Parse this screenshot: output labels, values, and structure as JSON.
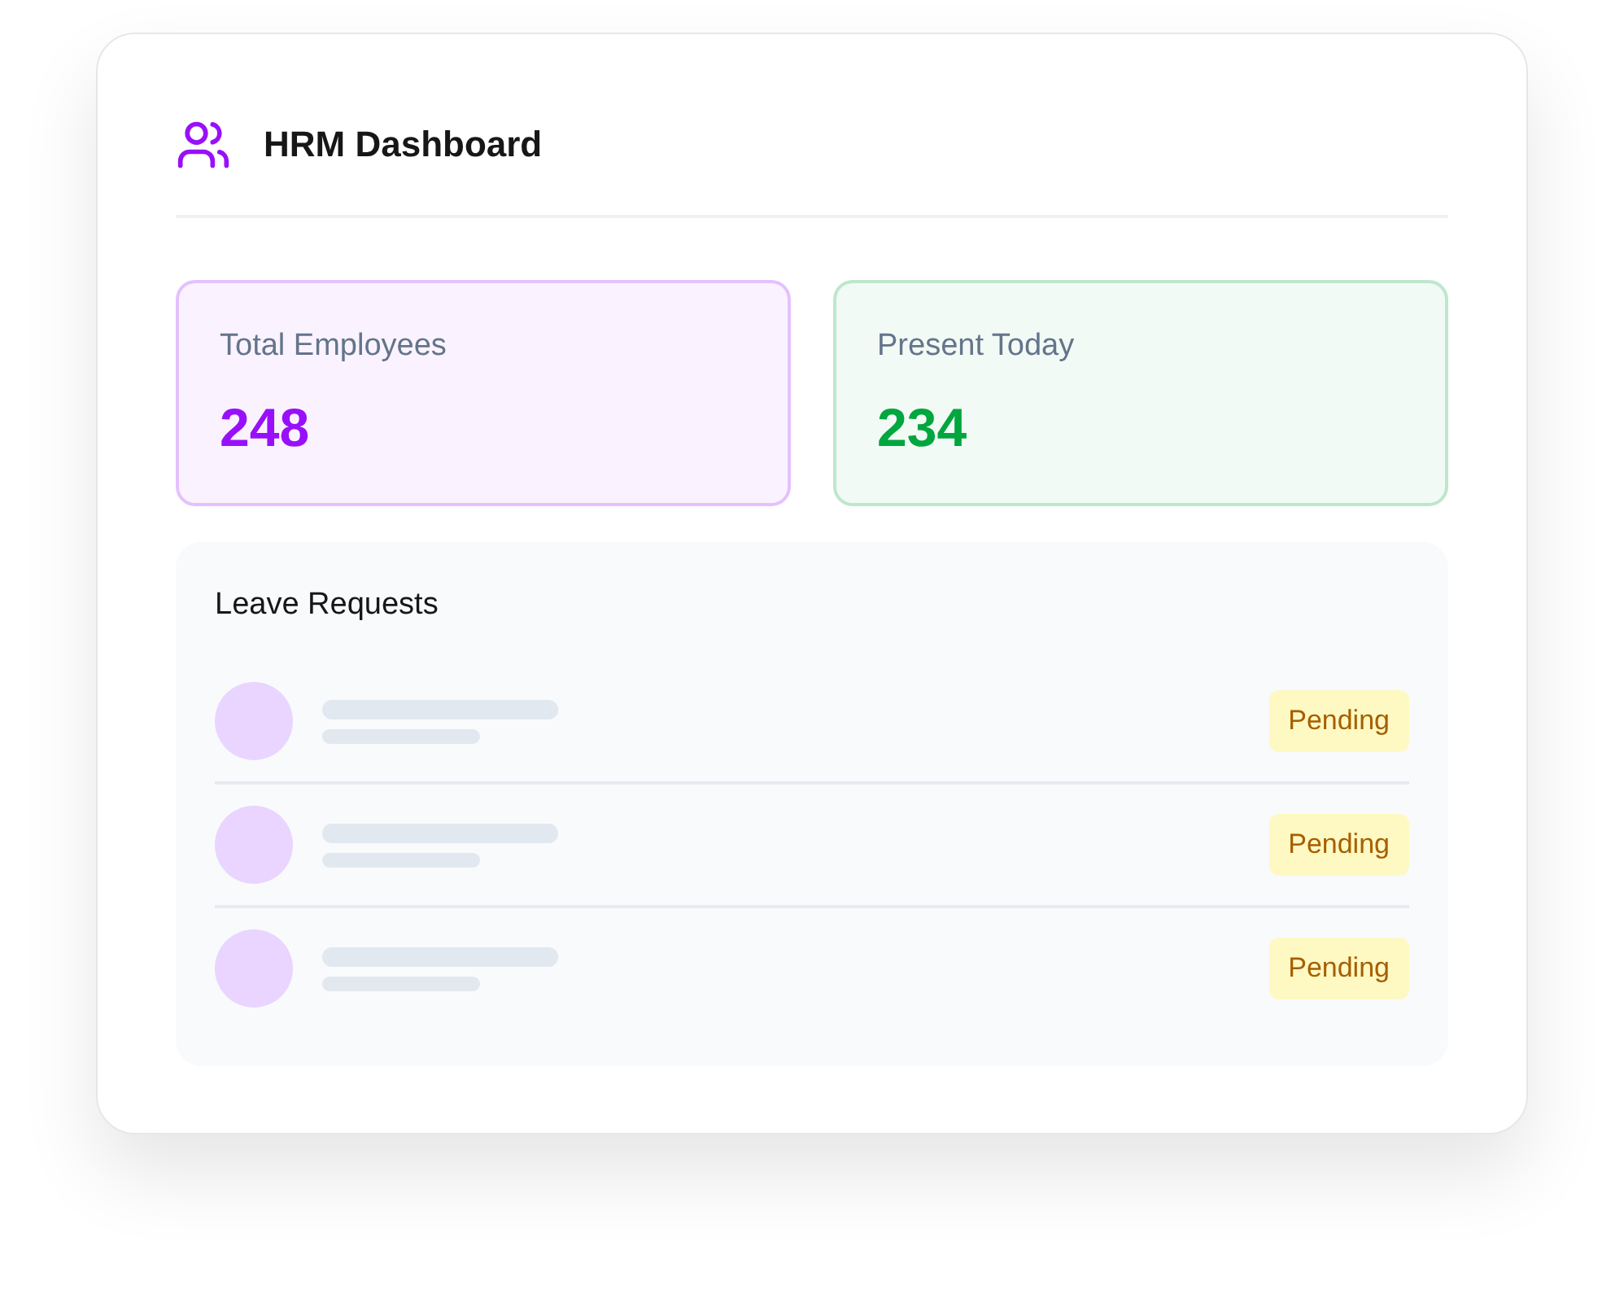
{
  "header": {
    "title": "HRM Dashboard"
  },
  "stats": [
    {
      "label": "Total Employees",
      "value": "248",
      "color": "#9810fa"
    },
    {
      "label": "Present Today",
      "value": "234",
      "color": "#00a63e"
    }
  ],
  "leave_requests": {
    "title": "Leave Requests",
    "rows": [
      {
        "status": "Pending"
      },
      {
        "status": "Pending"
      },
      {
        "status": "Pending"
      }
    ]
  }
}
